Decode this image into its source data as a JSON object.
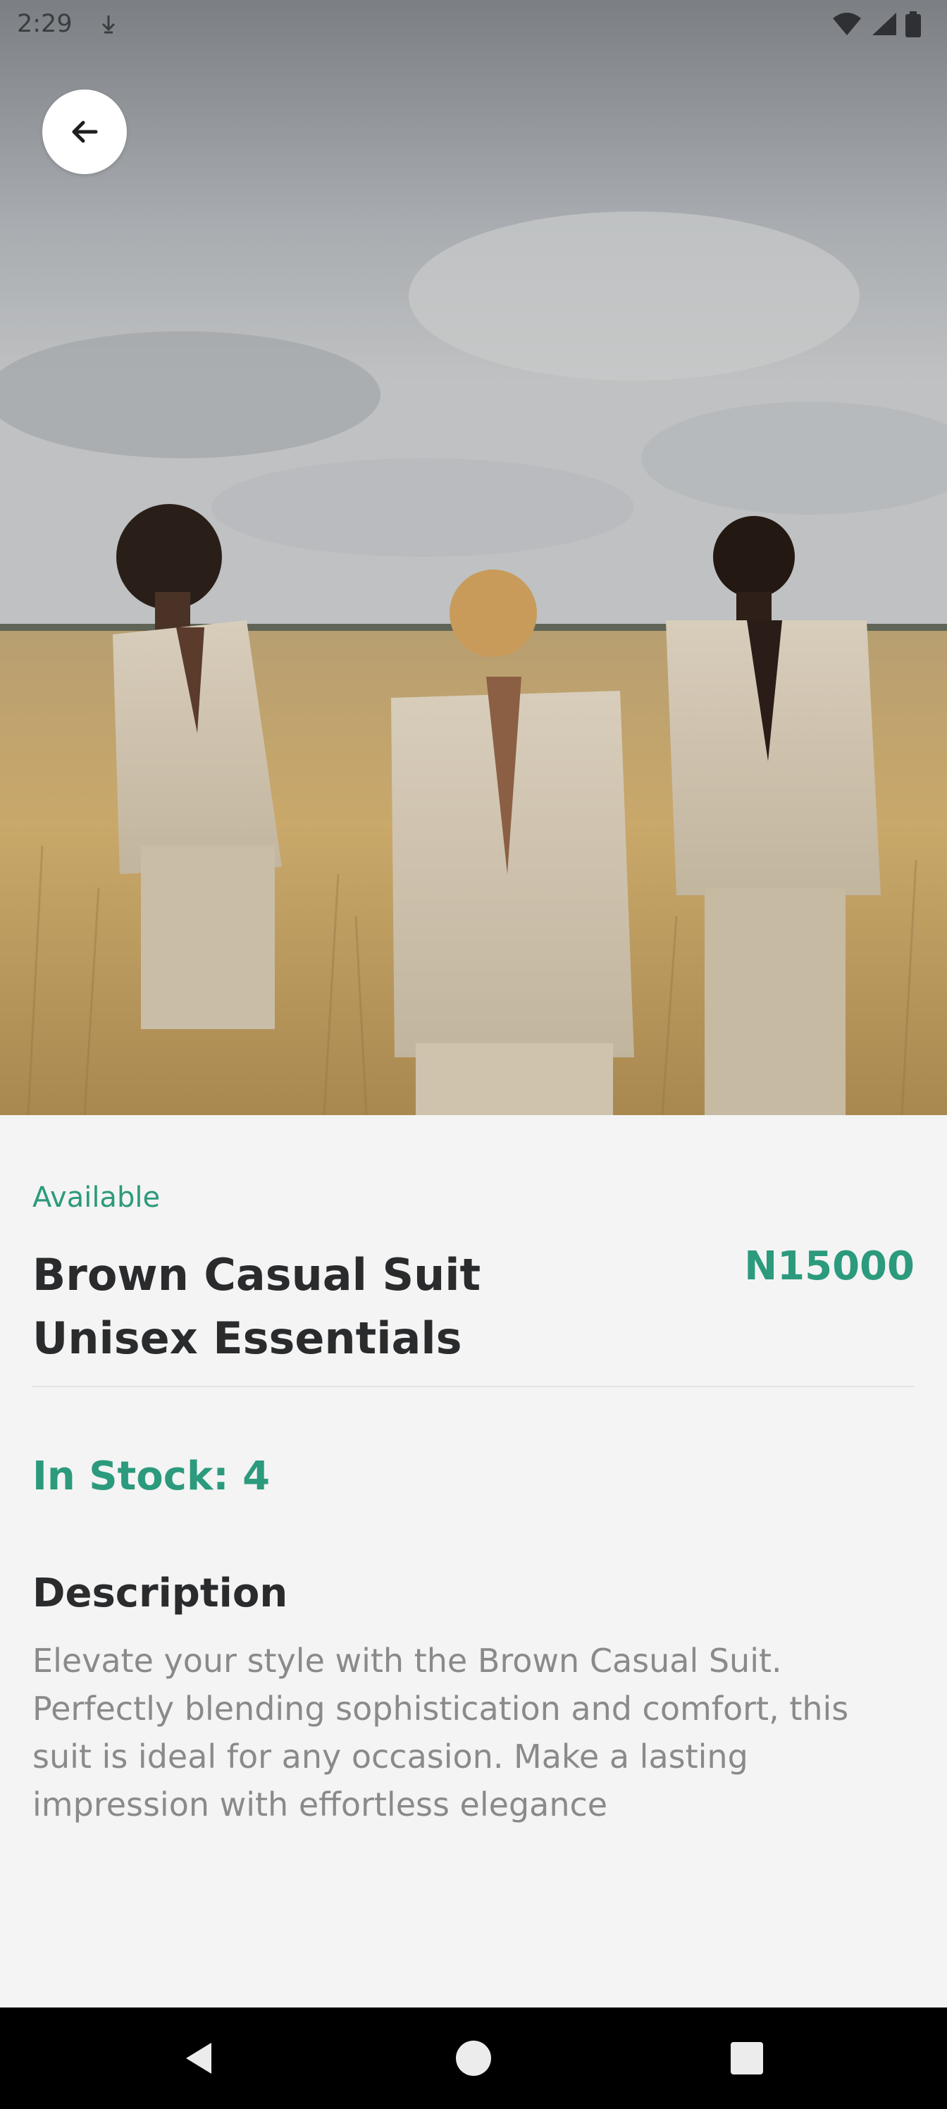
{
  "status_bar": {
    "time": "2:29",
    "icons": [
      "usb-debug-icon",
      "wifi-icon",
      "cell-signal-icon",
      "battery-icon"
    ]
  },
  "hero": {
    "image_description_icon": "product-photo",
    "back_icon": "arrow-left-icon"
  },
  "product": {
    "availability": "Available",
    "title": "Brown Casual Suit Unisex Essentials",
    "price": "N15000",
    "stock": "In Stock: 4",
    "description_heading": "Description",
    "description": "Elevate your style with the Brown Casual Suit. Perfectly blending sophistication and comfort, this suit is ideal for any occasion. Make a lasting impression with effortless elegance"
  },
  "colors": {
    "accent": "#2c9a7c",
    "text_dark": "#2a2b2d",
    "text_muted": "#8a8a8a",
    "background": "#f4f4f4"
  },
  "nav_bar": {
    "icons": [
      "back-triangle-icon",
      "home-circle-icon",
      "recents-square-icon"
    ]
  }
}
